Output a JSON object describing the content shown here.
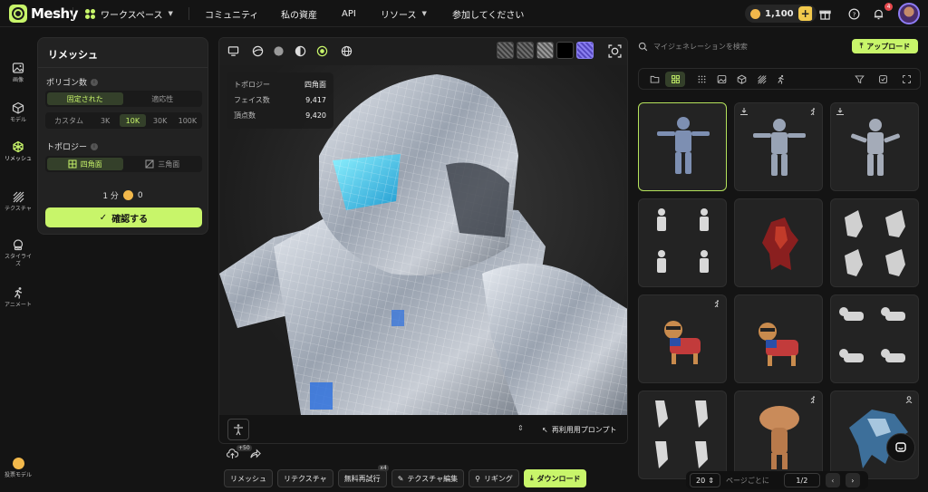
{
  "app": {
    "name": "Meshy",
    "accent": "#c8f56a"
  },
  "nav": {
    "workspace": "ワークスペース",
    "items": [
      "コミュニティ",
      "私の資産",
      "API",
      "リソース",
      "参加してください"
    ],
    "credits": "1,100",
    "notifications": "4"
  },
  "sidebar": {
    "items": [
      {
        "label": "画像",
        "icon": "image-icon"
      },
      {
        "label": "モデル",
        "icon": "cube-icon"
      },
      {
        "label": "リメッシュ",
        "icon": "remesh-icon"
      },
      {
        "label": "テクスチャ",
        "icon": "texture-icon"
      },
      {
        "label": "スタイライズ",
        "icon": "stylize-icon"
      },
      {
        "label": "アニメート",
        "icon": "animate-icon"
      }
    ],
    "bottom": "投票モデル"
  },
  "remesh_panel": {
    "title": "リメッシュ",
    "polycount_label": "ポリゴン数",
    "mode_options": [
      "固定された",
      "適応性"
    ],
    "mode_selected": "固定された",
    "count_options": [
      "カスタム",
      "3K",
      "10K",
      "30K",
      "100K"
    ],
    "count_selected": "10K",
    "topology_label": "トポロジー",
    "topology_options": [
      "四角面",
      "三角面"
    ],
    "topology_selected": "四角面",
    "time": "1 分",
    "cost": "0",
    "confirm": "確認する"
  },
  "stats": {
    "rows": [
      {
        "k": "トポロジー",
        "v": "四角面"
      },
      {
        "k": "フェイス数",
        "v": "9,417"
      },
      {
        "k": "頂点数",
        "v": "9,420"
      }
    ]
  },
  "viewer": {
    "reuse_prompt": "再利用用プロンプト",
    "plus50": "+50"
  },
  "actions": {
    "remesh": "リメッシュ",
    "retexture": "リテクスチャ",
    "free_retry": "無料再試行",
    "free_retry_badge": "x4",
    "texture_edit": "テクスチャ編集",
    "rigging": "リギング",
    "download": "ダウンロード"
  },
  "right": {
    "search_placeholder": "マイジェネレーションを検索",
    "upload": "アップロード",
    "page_size": "20",
    "per_page": "ページごとに",
    "page": "1/2"
  }
}
